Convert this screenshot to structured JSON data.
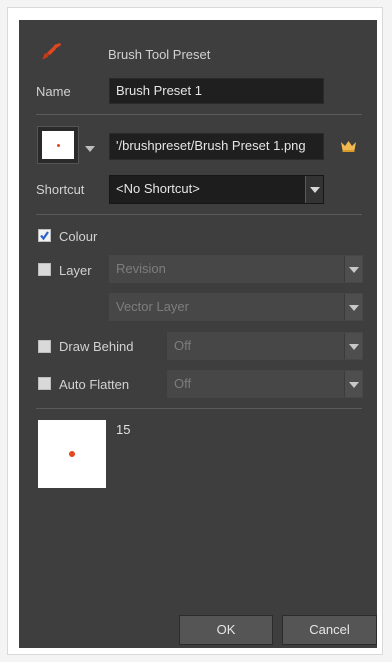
{
  "dialog": {
    "title": "Brush Tool Preset",
    "title_icon": "brush-icon",
    "name_label": "Name",
    "name_value": "Brush Preset 1",
    "thumbnail_path": "'/brushpreset/Brush Preset 1.png",
    "browse_icon": "crown-icon",
    "shortcut_label": "Shortcut",
    "shortcut_value": "<No Shortcut>",
    "colour_label": "Colour",
    "colour_checked": true,
    "layer_label": "Layer",
    "layer_checked": false,
    "layer_value": "Revision",
    "layer_type_value": "Vector Layer",
    "draw_behind_label": "Draw Behind",
    "draw_behind_checked": false,
    "draw_behind_value": "Off",
    "auto_flatten_label": "Auto Flatten",
    "auto_flatten_checked": false,
    "auto_flatten_value": "Off",
    "brush_size": "15",
    "ok_label": "OK",
    "cancel_label": "Cancel",
    "accent_color": "#e5461e",
    "crown_color": "#f2b950"
  }
}
